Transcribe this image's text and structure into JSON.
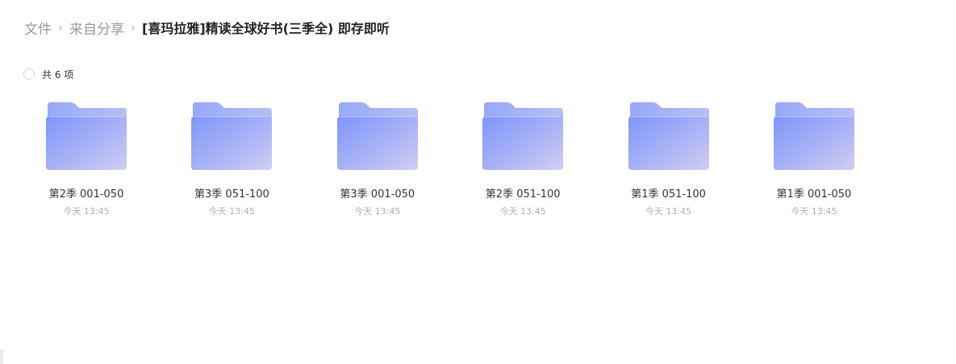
{
  "breadcrumb": {
    "items": [
      "文件",
      "来自分享"
    ],
    "current": "[喜玛拉雅]精读全球好书(三季全) 即存即听"
  },
  "selection": {
    "count_label": "共 6 项"
  },
  "colors": {
    "folder_front_start": "#7f95fb",
    "folder_front_end": "#d2cdf3",
    "folder_back": "#a3b1f7"
  },
  "files": [
    {
      "name": "第2季 001-050",
      "time": "今天 13:45",
      "icon": "folder-icon"
    },
    {
      "name": "第3季 051-100",
      "time": "今天 13:45",
      "icon": "folder-icon"
    },
    {
      "name": "第3季 001-050",
      "time": "今天 13:45",
      "icon": "folder-icon"
    },
    {
      "name": "第2季 051-100",
      "time": "今天 13:45",
      "icon": "folder-icon"
    },
    {
      "name": "第1季 051-100",
      "time": "今天 13:45",
      "icon": "folder-icon"
    },
    {
      "name": "第1季 001-050",
      "time": "今天 13:45",
      "icon": "folder-icon"
    }
  ]
}
